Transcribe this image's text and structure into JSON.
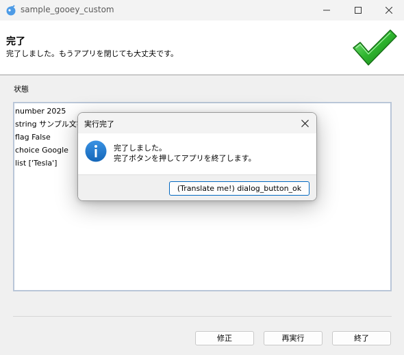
{
  "window": {
    "title": "sample_gooey_custom"
  },
  "header": {
    "title": "完了",
    "subtitle": "完了しました。もうアプリを閉じても大丈夫です。",
    "icon": "checkmark-icon"
  },
  "main": {
    "status_label": "状態",
    "console_lines": [
      "number 2025",
      "string サンプル文字列",
      "flag False",
      "choice Google",
      "list ['Tesla']"
    ]
  },
  "footer": {
    "buttons": {
      "edit": "修正",
      "rerun": "再実行",
      "finish": "終了"
    }
  },
  "dialog": {
    "title": "実行完了",
    "message_line1": "完了しました。",
    "message_line2": "完了ボタンを押してアプリを終了します。",
    "ok_label": "(Translate me!) dialog_button_ok",
    "icon": "info-icon"
  },
  "colors": {
    "accent": "#0067c0",
    "info_blue": "#1f7ad1",
    "check_green": "#2fb52f",
    "console_border": "#b9c6d8"
  }
}
